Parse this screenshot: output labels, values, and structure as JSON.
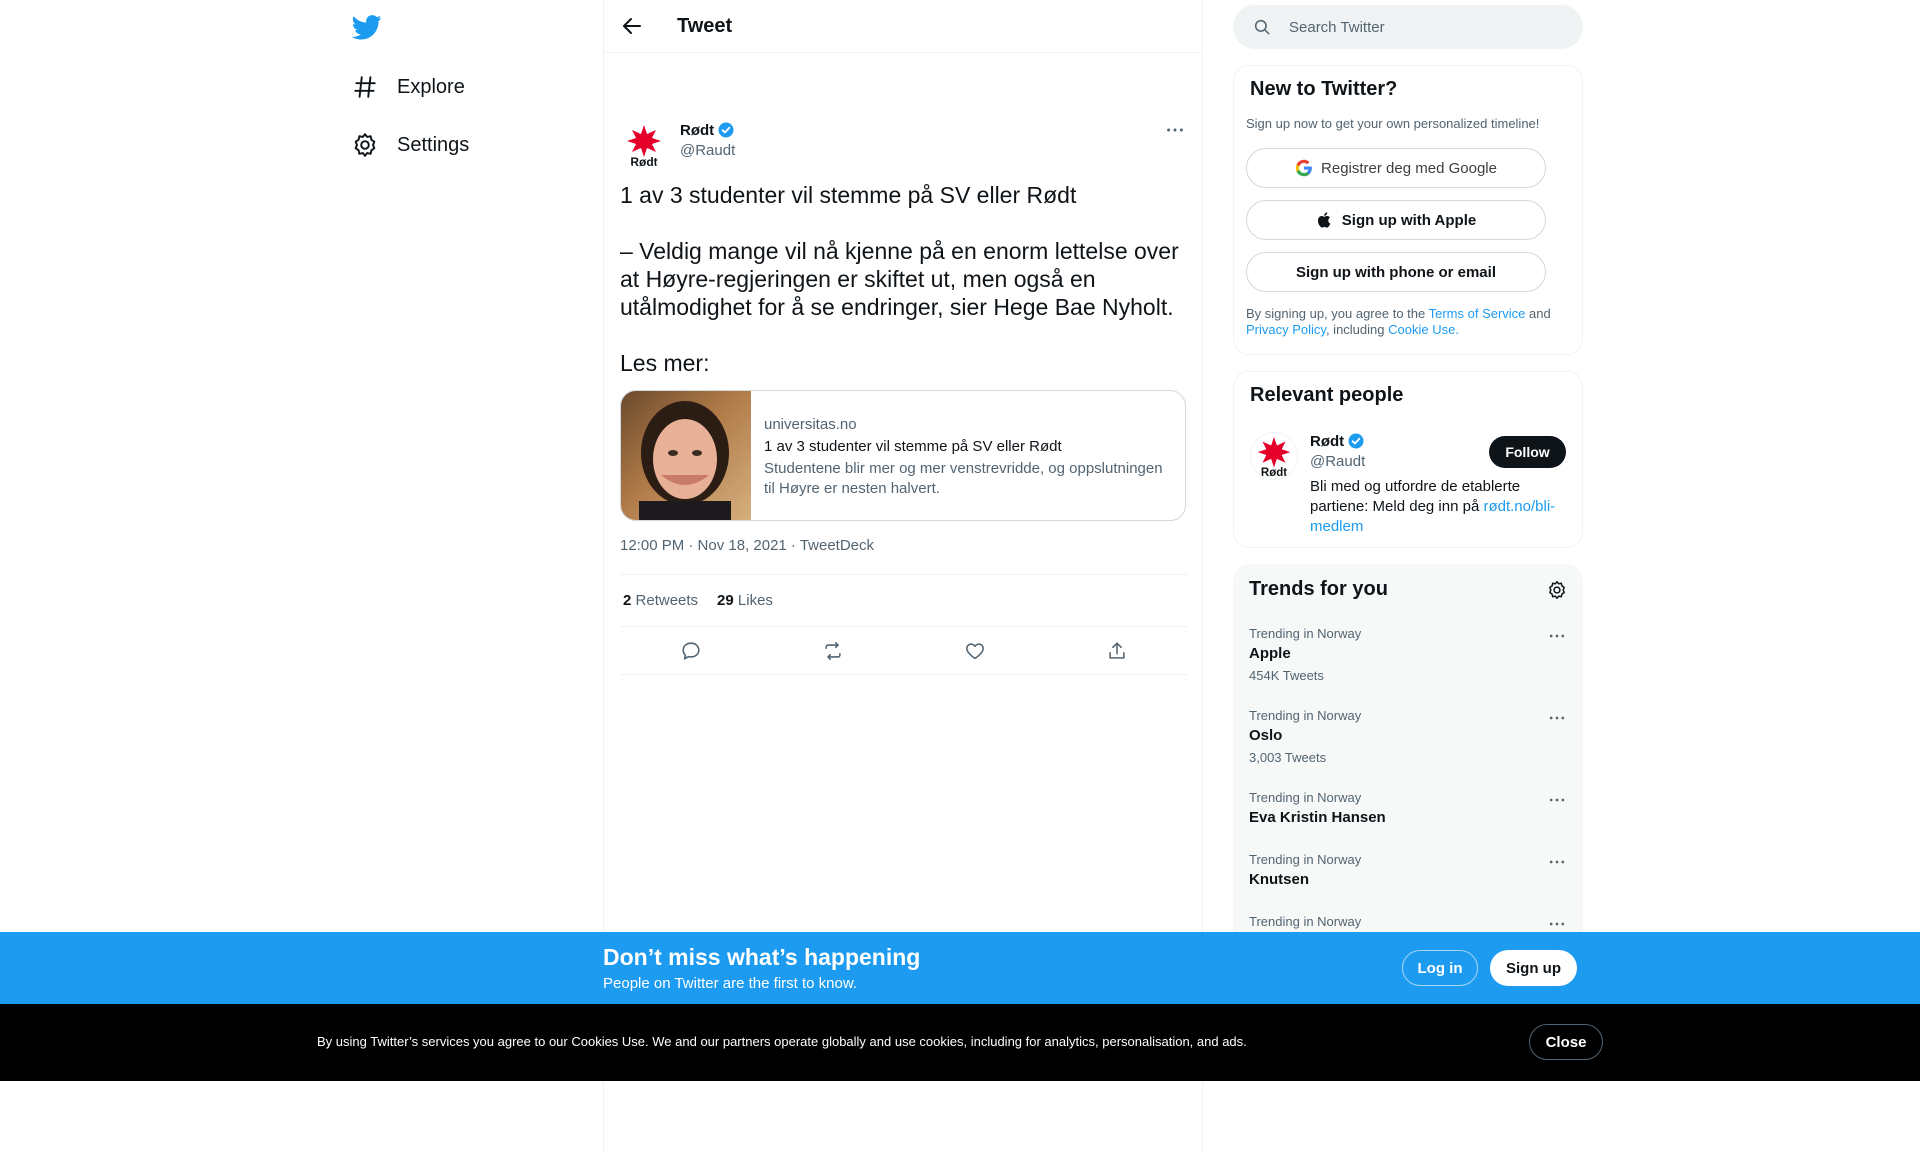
{
  "nav": {
    "items": [
      {
        "label": "Explore",
        "icon": "hashtag-icon"
      },
      {
        "label": "Settings",
        "icon": "gear-icon"
      }
    ]
  },
  "header": {
    "title": "Tweet"
  },
  "tweet": {
    "user_name": "Rødt",
    "handle": "@Raudt",
    "text": "1 av 3 studenter vil stemme på SV eller Rødt\n\n– Veldig mange vil nå kjenne på en enorm lettelse over at Høyre-regjeringen er skiftet ut, men også en utålmodighet for å se endringer, sier Hege Bae Nyholt.\n\nLes mer:",
    "avatar_text": "Rødt",
    "card": {
      "domain": "universitas.no",
      "title": "1 av 3 studenter vil stemme på SV eller Rødt",
      "description": "Studentene blir mer og mer venstrevridde, og oppslutningen til Høyre er nesten halvert."
    },
    "timestamp": "12:00 PM · Nov 18, 2021 · TweetDeck",
    "retweets_count": "2",
    "retweets_label": "Retweets",
    "likes_count": "29",
    "likes_label": "Likes"
  },
  "search": {
    "placeholder": "Search Twitter"
  },
  "signup": {
    "title": "New to Twitter?",
    "subtitle": "Sign up now to get your own personalized timeline!",
    "google_label": "Registrer deg med Google",
    "apple_label": "Sign up with Apple",
    "phone_label": "Sign up with phone or email",
    "legal_prefix": "By signing up, you agree to the ",
    "terms": "Terms of Service",
    "and": " and ",
    "privacy": "Privacy Policy",
    "including": ", including ",
    "cookie": "Cookie Use."
  },
  "relevant": {
    "title": "Relevant people",
    "name": "Rødt",
    "handle": "@Raudt",
    "bio": "Bli med og utfordre de etablerte partiene: Meld deg inn på ",
    "bio_link": "rødt.no/bli-medlem",
    "follow_label": "Follow"
  },
  "trends": {
    "title": "Trends for you",
    "items": [
      {
        "context": "Trending in Norway",
        "name": "Apple",
        "count": "454K Tweets"
      },
      {
        "context": "Trending in Norway",
        "name": "Oslo",
        "count": "3,003 Tweets"
      },
      {
        "context": "Trending in Norway",
        "name": "Eva Kristin Hansen",
        "count": ""
      },
      {
        "context": "Trending in Norway",
        "name": "Knutsen",
        "count": ""
      },
      {
        "context": "Trending in Norway",
        "name": "",
        "count": ""
      }
    ]
  },
  "banner": {
    "title": "Don’t miss what’s happening",
    "subtitle": "People on Twitter are the first to know.",
    "login_label": "Log in",
    "signup_label": "Sign up"
  },
  "cookie": {
    "text": "By using Twitter’s services you agree to our Cookies Use. We and our partners operate globally and use cookies, including for analytics, personalisation, and ads.",
    "close_label": "Close"
  },
  "colors": {
    "accent": "#1d9bf0",
    "text": "#0f1419",
    "muted": "#536471",
    "brand_red": "#e4002b"
  }
}
